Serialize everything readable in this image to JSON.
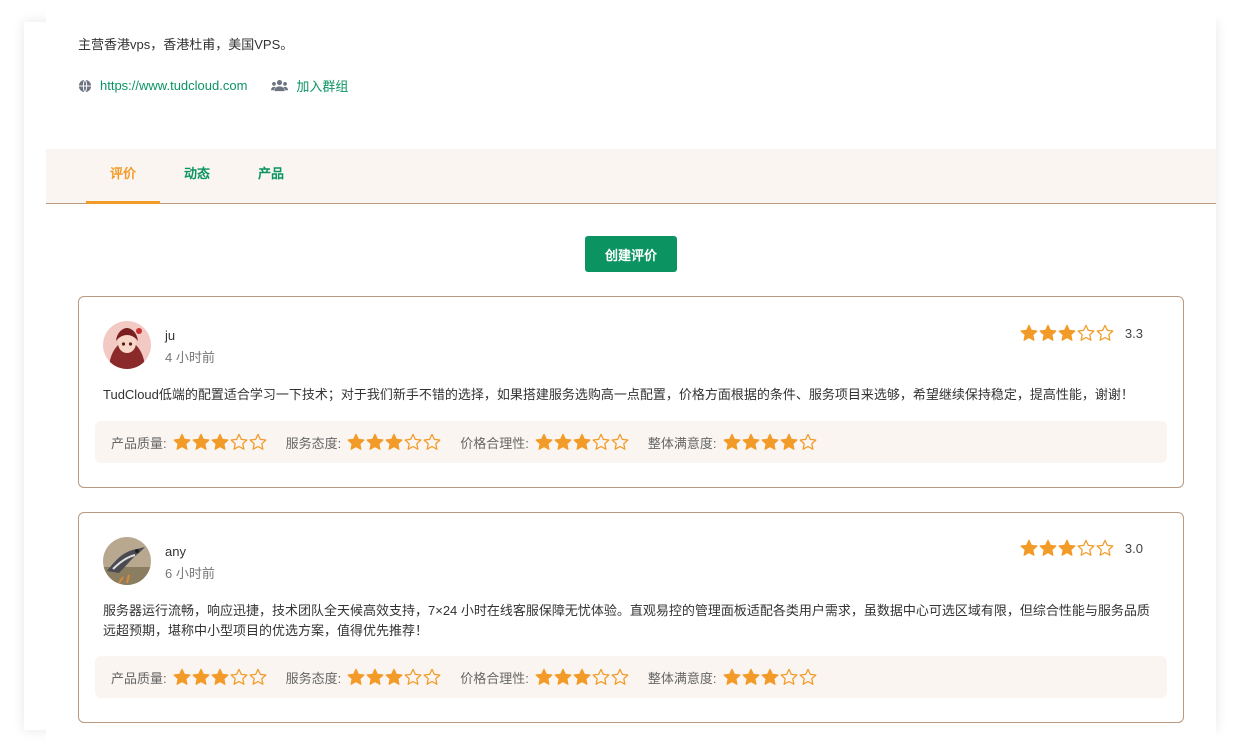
{
  "vendor": {
    "intro": "主营香港vps，香港杜甫，美国VPS。",
    "website": "https://www.tudcloud.com",
    "group_label": "加入群组",
    "website_icon": "globe-icon",
    "group_icon": "users-icon"
  },
  "tabs": [
    {
      "label": "评价",
      "active": true
    },
    {
      "label": "动态",
      "active": false
    },
    {
      "label": "产品",
      "active": false
    }
  ],
  "create_review_label": "创建评价",
  "colors": {
    "accent_green": "#0b9462",
    "accent_orange": "#f29b28",
    "star": "#f29b28",
    "border": "#b9997f",
    "panel_bg": "#faf5f1"
  },
  "reviews": [
    {
      "user": "ju",
      "time": "4 小时前",
      "overall_stars": 3,
      "overall_score": "3.3",
      "content": "TudCloud低端的配置适合学习一下技术；对于我们新手不错的选择，如果搭建服务选购高一点配置，价格方面根据的条件、服务项目来选够，希望继续保持稳定，提高性能，谢谢！",
      "ratings": [
        {
          "label": "产品质量:",
          "stars": 3
        },
        {
          "label": "服务态度:",
          "stars": 3
        },
        {
          "label": "价格合理性:",
          "stars": 3
        },
        {
          "label": "整体满意度:",
          "stars": 4
        }
      ]
    },
    {
      "user": "any",
      "time": "6 小时前",
      "overall_stars": 3,
      "overall_score": "3.0",
      "content": "服务器运行流畅，响应迅捷，技术团队全天候高效支持，7×24 小时在线客服保障无忧体验。直观易控的管理面板适配各类用户需求，虽数据中心可选区域有限，但综合性能与服务品质远超预期，堪称中小型项目的优选方案，值得优先推荐！",
      "ratings": [
        {
          "label": "产品质量:",
          "stars": 3
        },
        {
          "label": "服务态度:",
          "stars": 3
        },
        {
          "label": "价格合理性:",
          "stars": 3
        },
        {
          "label": "整体满意度:",
          "stars": 3
        }
      ]
    }
  ]
}
